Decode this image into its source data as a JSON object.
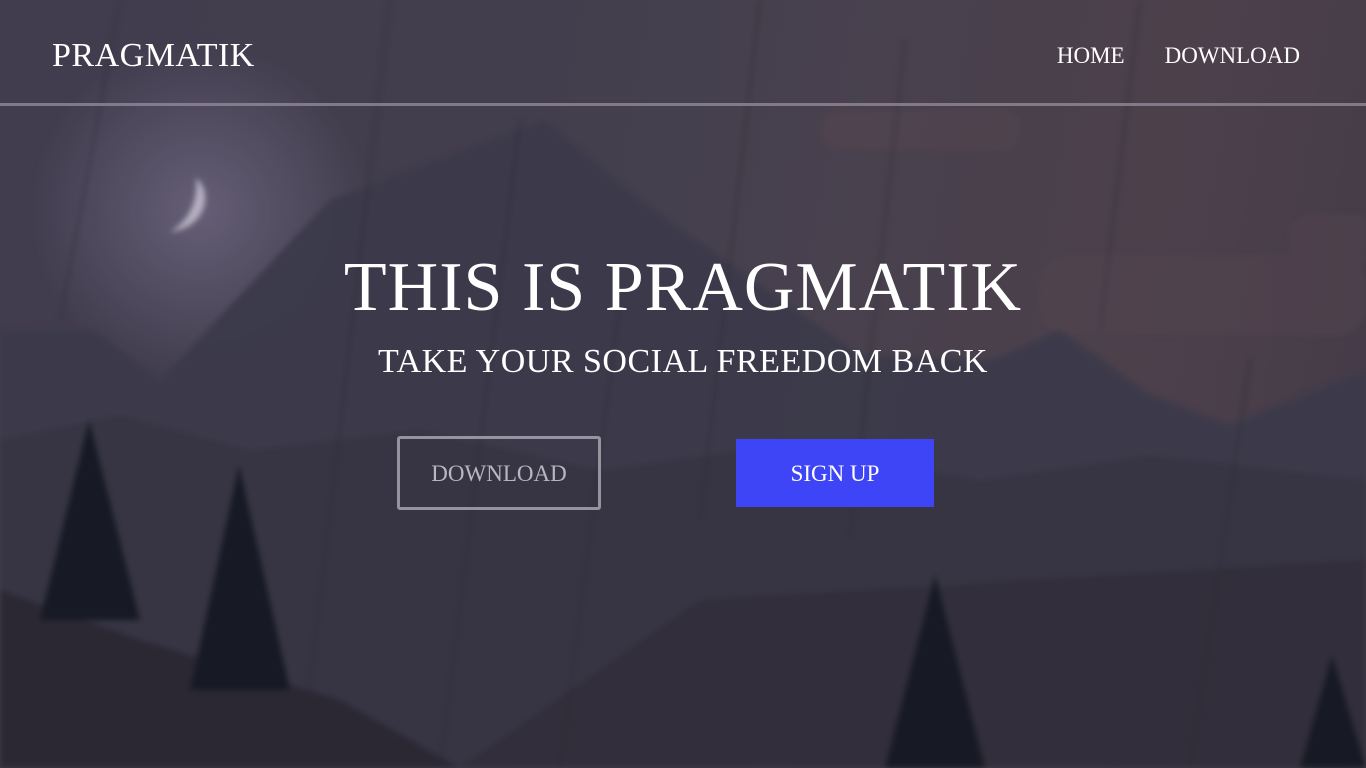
{
  "navbar": {
    "brand": "PRAGMATIK",
    "links": [
      {
        "label": "HOME"
      },
      {
        "label": "DOWNLOAD"
      }
    ]
  },
  "hero": {
    "title": "THIS IS PRAGMATIK",
    "subtitle": "TAKE YOUR SOCIAL FREEDOM BACK",
    "download_label": "DOWNLOAD",
    "signup_label": "SIGN UP"
  },
  "colors": {
    "accent": "#3d45f6",
    "text": "#ffffff",
    "background": "#4b4656"
  },
  "background_scene": {
    "moon": "crescent-moon",
    "elements": [
      "mountains",
      "pine-trees",
      "clouds",
      "rain"
    ]
  }
}
